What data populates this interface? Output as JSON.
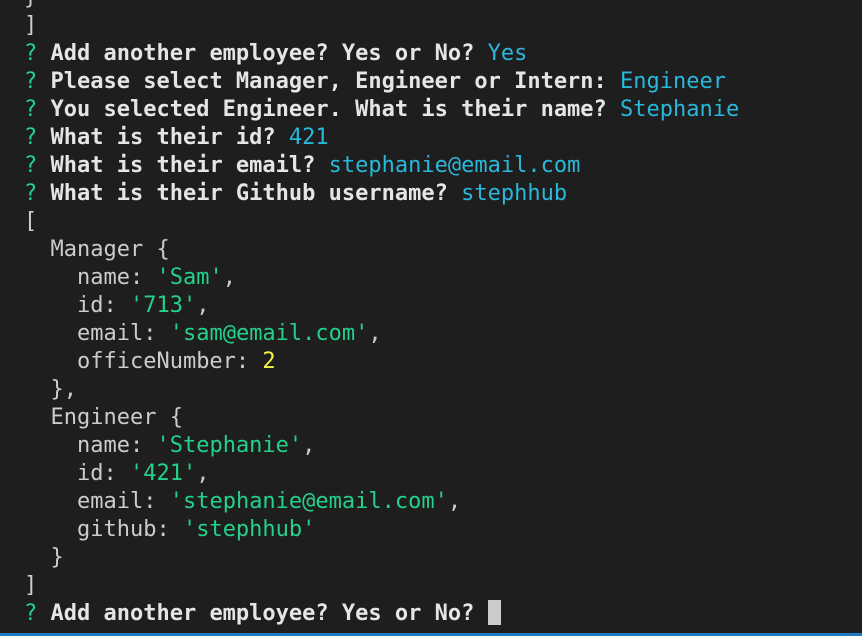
{
  "terminal": {
    "prompt_marker": "?",
    "line0": "}",
    "line1": "]",
    "q1": {
      "question": "Add another employee? Yes or No?",
      "answer": "Yes"
    },
    "q2": {
      "question": "Please select Manager, Engineer or Intern:",
      "answer": "Engineer"
    },
    "q3": {
      "question": "You selected Engineer. What is their name?",
      "answer": "Stephanie"
    },
    "q4": {
      "question": "What is their id?",
      "answer": "421"
    },
    "q5": {
      "question": "What is their email?",
      "answer": "stephanie@email.com"
    },
    "q6": {
      "question": "What is their Github username?",
      "answer": "stephhub"
    },
    "array_open": "[",
    "manager": {
      "class": "Manager {",
      "name_key": "name:",
      "name_val": "'Sam'",
      "id_key": "id:",
      "id_val": "'713'",
      "email_key": "email:",
      "email_val": "'sam@email.com'",
      "office_key": "officeNumber:",
      "office_val": "2",
      "close": "},"
    },
    "engineer": {
      "class": "Engineer {",
      "name_key": "name:",
      "name_val": "'Stephanie'",
      "id_key": "id:",
      "id_val": "'421'",
      "email_key": "email:",
      "email_val": "'stephanie@email.com'",
      "github_key": "github:",
      "github_val": "'stephhub'",
      "close": "}"
    },
    "array_close": "]",
    "q7": {
      "question": "Add another employee? Yes or No?"
    }
  },
  "colors": {
    "background": "#1e1e1e",
    "prompt_marker": "#23d18b",
    "answer": "#29b8db",
    "string": "#23d18b",
    "number": "#f5f543"
  }
}
